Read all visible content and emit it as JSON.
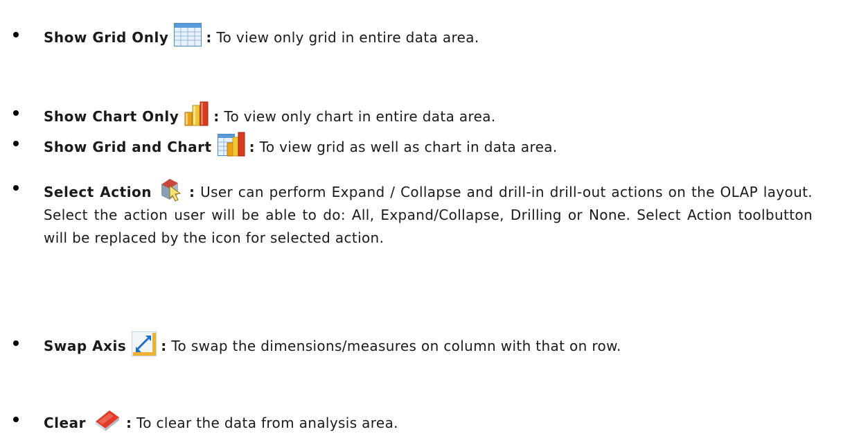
{
  "items": [
    {
      "title": "Show Grid Only",
      "icon": "grid-icon",
      "description": "To view only grid in entire data area."
    },
    {
      "title": "Show Chart Only",
      "icon": "bar-chart-icon",
      "description": "To view only chart in entire data area."
    },
    {
      "title": "Show Grid and Chart",
      "icon": "grid-chart-icon",
      "description": "To view grid as well as chart in data area."
    },
    {
      "title": "Select Action",
      "icon": "select-action-icon",
      "description": "User can perform Expand / Collapse and drill-in drill-out actions on the OLAP layout.  Select the action user will be able to do: All, Expand/Collapse, Drilling or None.  Select Action toolbutton will be replaced by the icon for selected action."
    },
    {
      "title": "Swap Axis",
      "icon": "swap-axis-icon",
      "description": "To swap the dimensions/measures on column with that on row."
    },
    {
      "title": "Clear",
      "icon": "eraser-icon",
      "description": "To clear the data from analysis area."
    }
  ],
  "colon": ":"
}
